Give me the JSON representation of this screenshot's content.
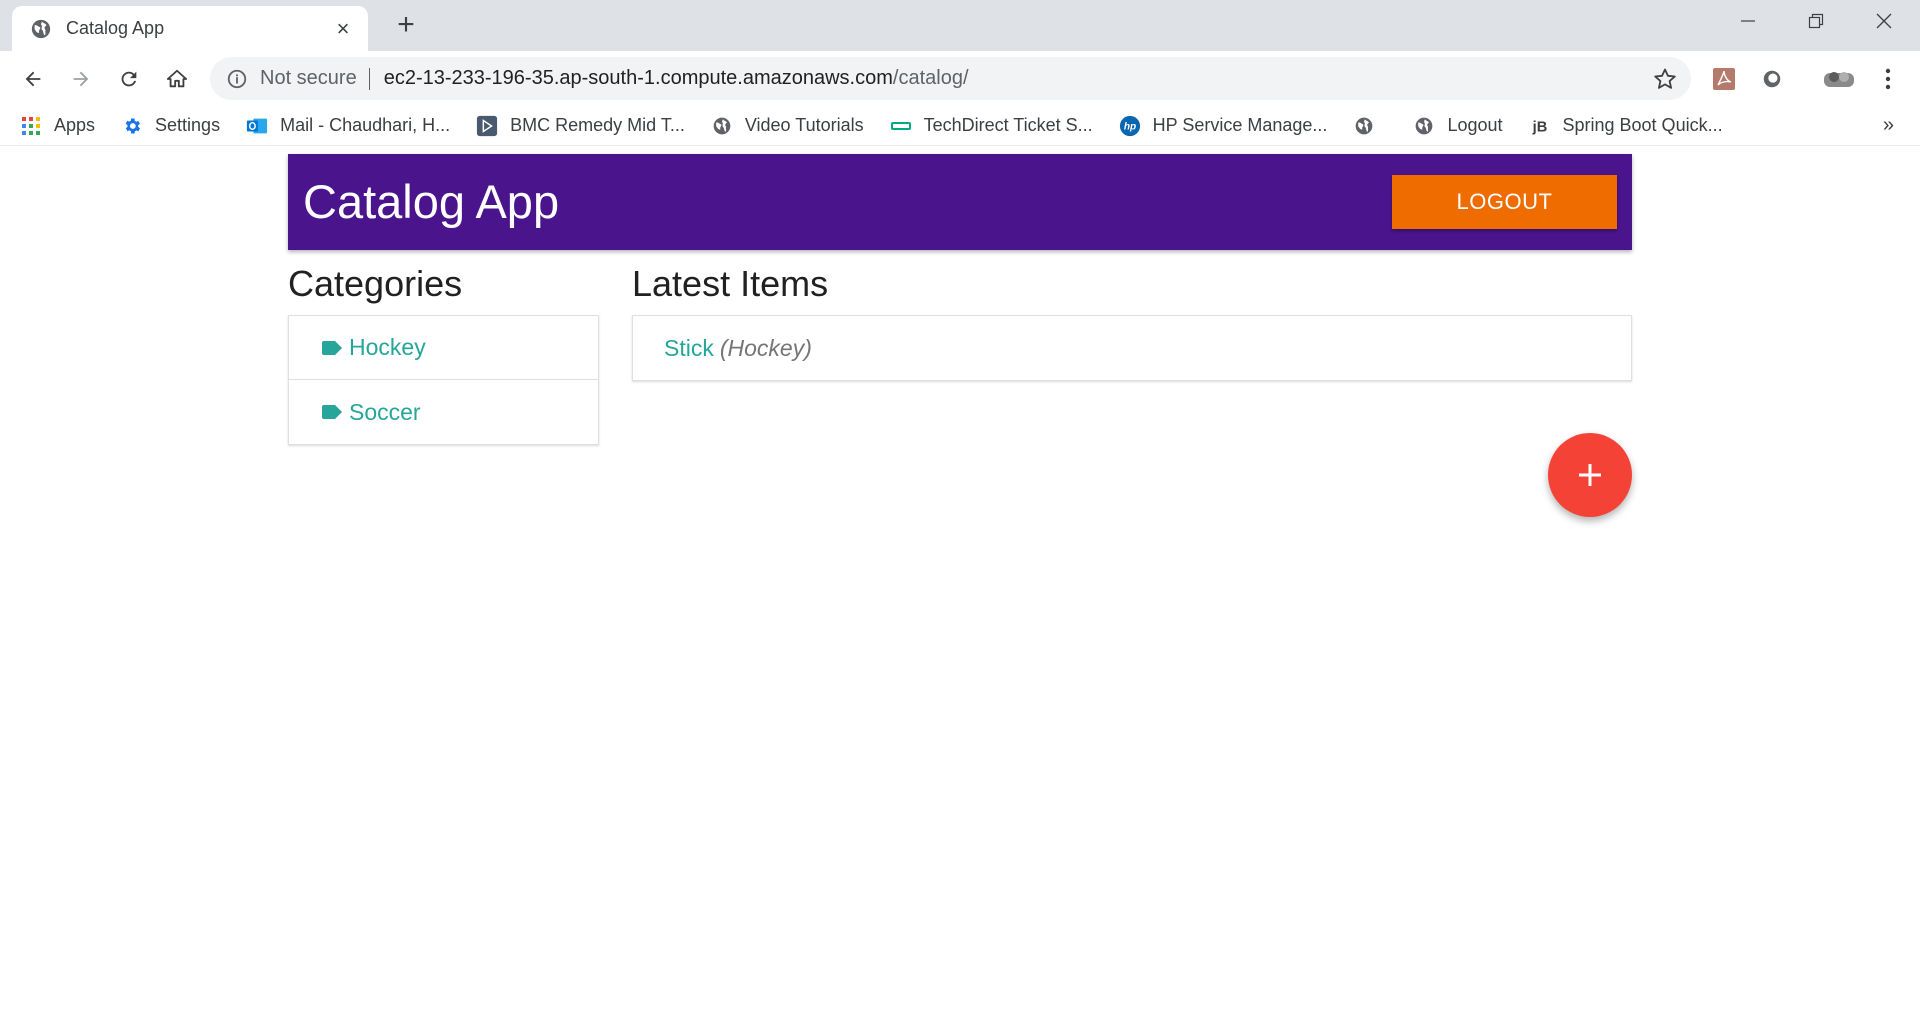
{
  "browser": {
    "tab_title": "Catalog App",
    "new_tab_label": "+",
    "omnibox": {
      "security_label": "Not secure",
      "url_host": "ec2-13-233-196-35.ap-south-1.compute.amazonaws.com",
      "url_path": "/catalog/"
    },
    "bookmarks": [
      {
        "label": "Apps",
        "icon": "apps-grid-icon"
      },
      {
        "label": "Settings",
        "icon": "gear-icon"
      },
      {
        "label": "Mail - Chaudhari, H...",
        "icon": "outlook-icon"
      },
      {
        "label": "BMC Remedy Mid T...",
        "icon": "bmc-icon"
      },
      {
        "label": "Video Tutorials",
        "icon": "globe-icon"
      },
      {
        "label": "TechDirect Ticket S...",
        "icon": "techdirect-icon"
      },
      {
        "label": "HP Service Manage...",
        "icon": "hp-icon"
      },
      {
        "label": "",
        "icon": "globe-icon"
      },
      {
        "label": "Logout",
        "icon": "globe-icon"
      },
      {
        "label": "Spring Boot Quick...",
        "icon": "jb-icon"
      }
    ],
    "bookmarks_more": "»"
  },
  "app": {
    "title": "Catalog App",
    "logout_label": "LOGOUT",
    "categories_title": "Categories",
    "categories": [
      {
        "name": "Hockey"
      },
      {
        "name": "Soccer"
      }
    ],
    "latest_title": "Latest Items",
    "latest_items": [
      {
        "name": "Stick",
        "category": "(Hockey)"
      }
    ],
    "fab_label": "+"
  },
  "colors": {
    "header_bg": "#4a148c",
    "logout_bg": "#ef6c00",
    "link": "#26a69a",
    "fab_bg": "#f44336"
  }
}
